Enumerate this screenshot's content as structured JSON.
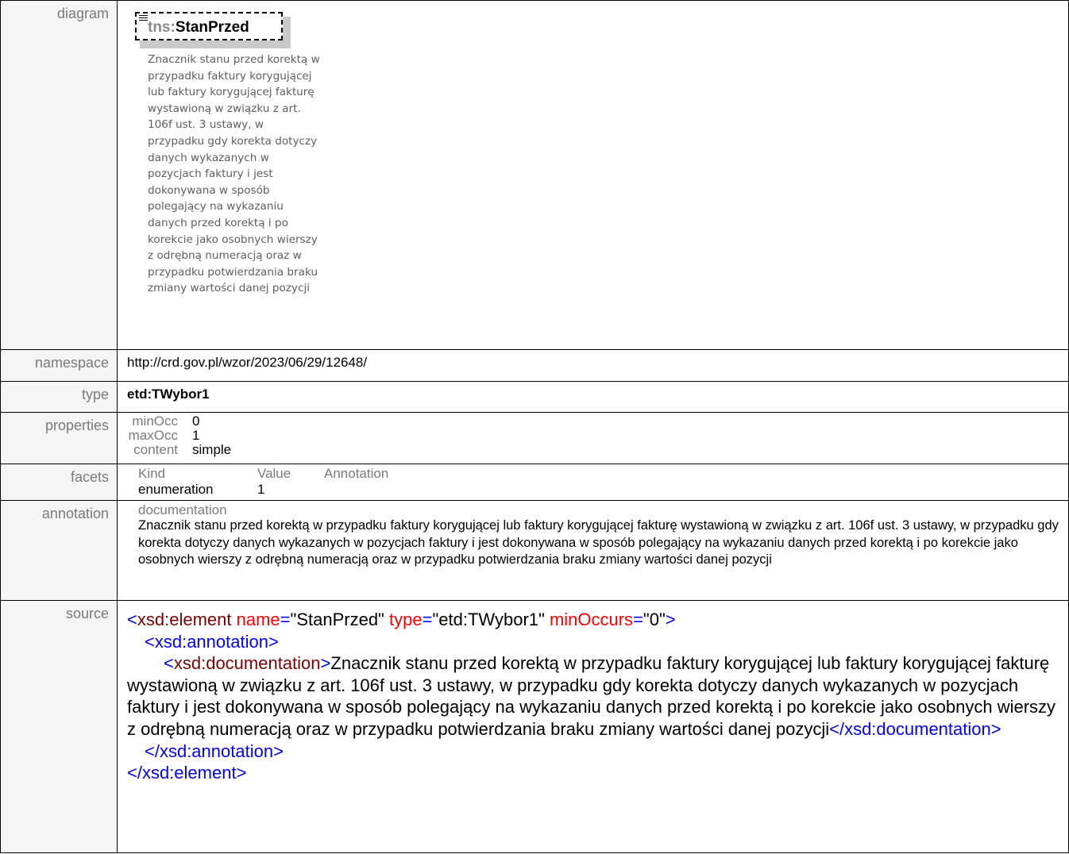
{
  "labels": {
    "diagram": "diagram",
    "namespace": "namespace",
    "type": "type",
    "properties": "properties",
    "facets": "facets",
    "annotation": "annotation",
    "source": "source"
  },
  "diagram": {
    "element_prefix": "tns:",
    "element_name": "StanPrzed",
    "doc_lines": [
      "Znacznik stanu przed korektą w",
      "przypadku faktury korygującej",
      "lub faktury korygującej fakturę",
      "wystawioną w związku z art.",
      "106f ust. 3 ustawy, w",
      "przypadku gdy korekta dotyczy",
      "danych wykazanych w",
      "pozycjach faktury i jest",
      "dokonywana w sposób",
      "polegający na wykazaniu",
      "danych przed korektą i po",
      "korekcie jako osobnych wierszy",
      "z odrębną numeracją oraz w",
      "przypadku potwierdzania braku",
      "zmiany wartości danej pozycji"
    ]
  },
  "namespace": "http://crd.gov.pl/wzor/2023/06/29/12648/",
  "type": "etd:TWybor1",
  "properties": [
    {
      "key": "minOcc",
      "value": "0"
    },
    {
      "key": "maxOcc",
      "value": "1"
    },
    {
      "key": "content",
      "value": "simple"
    }
  ],
  "facets": {
    "headers": [
      "Kind",
      "Value",
      "Annotation"
    ],
    "rows": [
      {
        "kind": "enumeration",
        "value": "1",
        "annotation": ""
      }
    ]
  },
  "annotation": {
    "heading": "documentation",
    "text": "Znacznik stanu przed korektą w przypadku faktury korygującej lub faktury korygującej fakturę wystawioną w związku z art. 106f ust. 3 ustawy, w przypadku gdy korekta dotyczy danych wykazanych w pozycjach faktury i jest dokonywana w sposób polegający na wykazaniu danych przed korektą i po korekcie jako osobnych wierszy z odrębną numeracją oraz w przypadku potwierdzania braku zmiany wartości danej pozycji"
  },
  "source": {
    "open_lt": "<",
    "close_gt": ">",
    "element_tag": "xsd:element",
    "attr_name": "name",
    "attr_name_val": "\"StanPrzed\"",
    "attr_type": "type",
    "attr_type_val": "\"etd:TWybor1\"",
    "attr_min": "minOccurs",
    "attr_min_val": "\"0\"",
    "eq": "=",
    "annotation_open": "<xsd:annotation>",
    "documentation_open_tag": "xsd:documentation",
    "documentation_close": "</xsd:documentation>",
    "annotation_close": "</xsd:annotation>",
    "element_close": "</xsd:element>",
    "doc_text": "Znacznik stanu przed korektą w przypadku faktury korygującej lub faktury korygującej fakturę wystawioną w związku z art. 106f ust. 3 ustawy, w przypadku gdy korekta dotyczy danych wykazanych w pozycjach faktury i jest dokonywana w sposób polegający na wykazaniu danych przed korektą i po korekcie jako osobnych wierszy z odrębną numeracją oraz w przypadku potwierdzania braku zmiany wartości danej pozycji"
  }
}
